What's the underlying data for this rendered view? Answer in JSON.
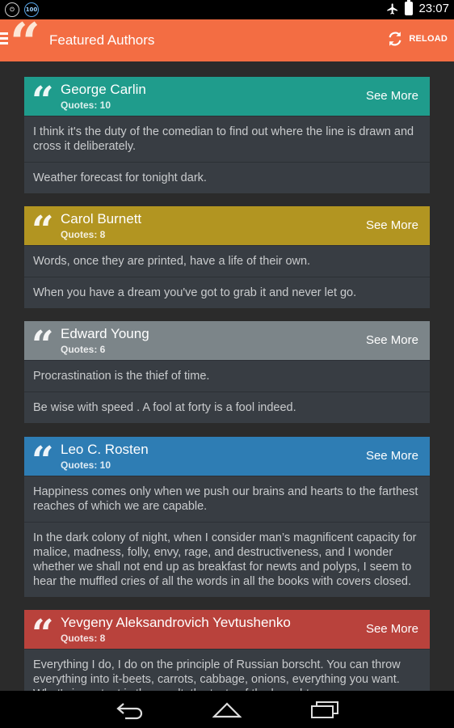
{
  "status_bar": {
    "time": "23:07",
    "left_icons": [
      {
        "name": "power-icon",
        "glyph": "⏻"
      },
      {
        "name": "100-badge-icon",
        "glyph": "100"
      }
    ],
    "right_icons": [
      "airplane-icon",
      "battery-icon"
    ]
  },
  "action_bar": {
    "title": "Featured Authors",
    "reload_label": "RELOAD",
    "background": "#f36d43",
    "quote_glyph": "“"
  },
  "authors": [
    {
      "name": "George Carlin",
      "count": "Quotes: 10",
      "see_more": "See More",
      "color": "#1f9c8c",
      "quotes": [
        "I think it's the duty of the comedian to find out where the line is drawn and cross it deliberately.",
        "Weather forecast for tonight dark."
      ]
    },
    {
      "name": "Carol Burnett",
      "count": "Quotes: 8",
      "see_more": "See More",
      "color": "#b29521",
      "quotes": [
        "Words, once they are printed, have a life of their own.",
        "When you have a dream you've got to grab it and never let go."
      ]
    },
    {
      "name": "Edward Young",
      "count": "Quotes: 6",
      "see_more": "See More",
      "color": "#7c8589",
      "quotes": [
        "Procrastination is the thief of time.",
        "Be wise with speed . A fool at forty is a fool indeed."
      ]
    },
    {
      "name": "Leo C. Rosten",
      "count": "Quotes: 10",
      "see_more": "See More",
      "color": "#2e7db4",
      "quotes": [
        "Happiness comes only when we push our brains and hearts to the farthest reaches of which we are capable.",
        "In the dark colony of night, when I consider man’s magnificent capacity for malice, madness, folly, envy, rage, and destructiveness, and I wonder whether we shall not end up as breakfast for newts and polyps, I seem to hear the muffled cries of all the words in all the books with covers closed."
      ]
    },
    {
      "name": "Yevgeny Aleksandrovich Yevtushenko",
      "count": "Quotes: 8",
      "see_more": "See More",
      "color": "#b9423c",
      "quotes": [
        "Everything I do, I do on the principle of Russian borscht. You can throw everything into it-beets, carrots, cabbage, onions, everything you want. What's important is the result, the taste of the borscht."
      ]
    }
  ],
  "nav_bar": {
    "buttons": [
      "back-icon",
      "home-icon",
      "recents-icon"
    ]
  }
}
